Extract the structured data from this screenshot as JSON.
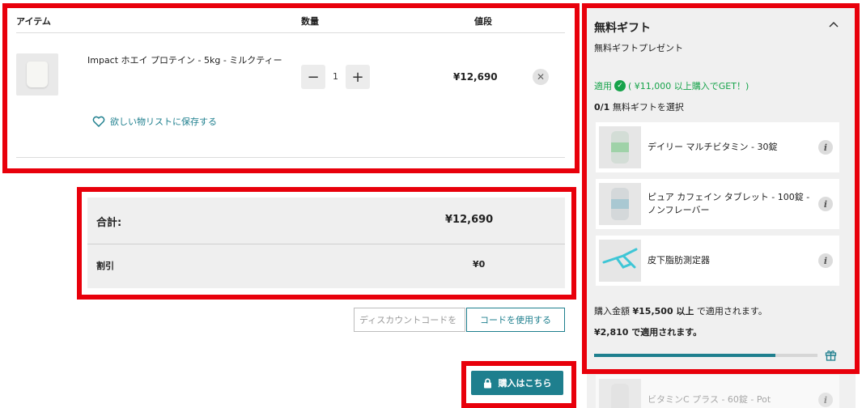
{
  "cart": {
    "headers": {
      "item": "アイテム",
      "qty": "数量",
      "price": "値段"
    },
    "product": {
      "name": "Impact ホエイ プロテイン - 5kg - ミルクティー",
      "quantity": "1",
      "price": "¥12,690",
      "minus": "−",
      "plus": "+",
      "remove": "✕"
    },
    "wishlist_label": "欲しい物リストに保存する"
  },
  "totals": {
    "total_label": "合計:",
    "total_value": "¥12,690",
    "discount_label": "割引",
    "discount_value": "¥0"
  },
  "discount_code": {
    "placeholder": "ディスカウントコードを",
    "button_label": "コードを使用する"
  },
  "checkout": {
    "label": "購入はこちら"
  },
  "gift": {
    "title": "無料ギフト",
    "subtitle": "無料ギフトプレゼント",
    "applied_prefix": "適用",
    "applied_suffix": "( ¥11,000 以上購入でGET！)",
    "count_bold": "0/1",
    "count_text": " 無料ギフトを選択",
    "items": [
      {
        "name": "デイリー マルチビタミン - 30錠"
      },
      {
        "name": "ピュア カフェイン タブレット - 100錠 - ノンフレーバー"
      },
      {
        "name": "皮下脂肪測定器"
      },
      {
        "name": "ビタミンC プラス - 60錠 - Pot"
      }
    ],
    "req_prefix": "購入金額 ",
    "req_bold": "¥15,500 以上",
    "req_suffix": " で適用されます。",
    "req2": "¥2,810 で適用されます。",
    "progress": 0.81
  },
  "colors": {
    "accent": "#1e7f8e",
    "success": "#16a34a",
    "highlight": "#e8000b"
  }
}
